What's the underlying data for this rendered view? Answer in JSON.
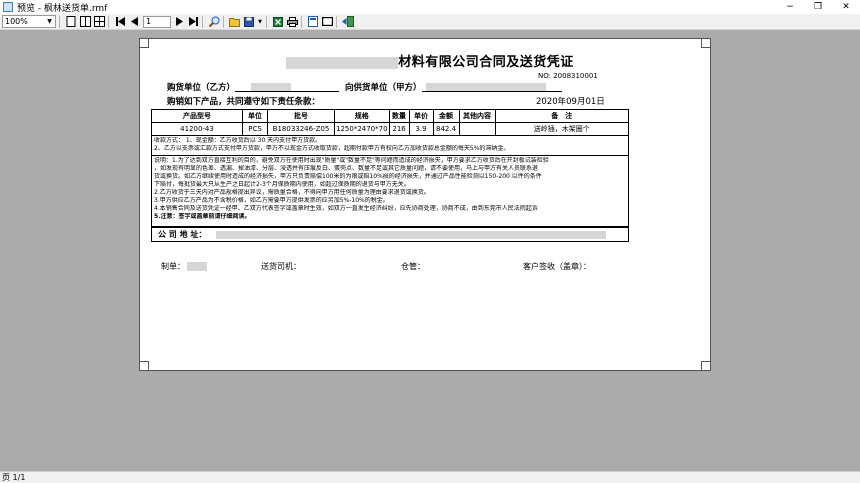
{
  "window": {
    "title": "预览 - 枫林送货单.rmf",
    "controls": [
      "−",
      "❐",
      "✕"
    ]
  },
  "toolbar": {
    "zoom_value": "100%",
    "page_value": "1"
  },
  "document": {
    "title_suffix": "材料有限公司合同及送货凭证",
    "number": "NO: 2008310001",
    "buyer_label": "购货单位（乙方）",
    "seller_label": "向供货单位（甲方）",
    "buyer_line2": "购销如下产品，共同遵守如下责任条款：",
    "date": "2020年09月01日",
    "table": {
      "headers": [
        "产品型号",
        "单位",
        "批号",
        "规格",
        "数量",
        "单价",
        "金额",
        "其他内容",
        "备　注"
      ],
      "row": [
        "41200-43",
        "PCS",
        "B18033246-Z05",
        "1250*2470*70",
        "216",
        "3.9",
        "842.4",
        "",
        "送岭插，木架圈个"
      ]
    },
    "settlement": [
      "收款方式：  1、现金额：乙方收货后以  30  天内支付甲方货款。",
      "              2、乙方以支票或汇款方式支付甲方货款，甲方不以现金方式收取货款，超期付款甲方有权向乙方加收货款总金额的每天5%的滞纳金。"
    ],
    "notes": [
      "说明：1.为了达到双方直接互利的目的，避免双方在使用时出现\"质量\"或\"数量不足\"等问题而造成的经济损失，甲方要求乙方收货后在开封板试装检验",
      "        ，如发现有明显的色差、透漏、掉油漆、分层、浸透并有压痕反白、蛋壳点、数量不足或其它质量问题，请不要使用，马上与甲方有关人员联系退",
      "        货或换货。如乙方继续使用时造成的经济损失，甲方只负责赔偿100米的为限或赔10%损的经济损失，并通过产品性能检测以150-200 以件的条件",
      "        下赔付，每批货最大只从生产之日起计2-3个月保质期内使用，如超过保质期的退货与甲方无关。",
      "2.乙方收货于三天内对产品规格提出异议，需质量合格，不得向甲方用任何质量为理由要求退货或换货。",
      "3.甲方供应乙方产品为不含税价格，如乙方需要甲方提供发票的应另加5%-10%的税金。",
      "4.本销售合同及送货凭证一经甲、乙双方代表签字或盖章时生效，如双方一直发生经济纠纷，应先协商处理，协商不成，由到东莞市人民法院起诉",
      "5.注意：签字或盖章前请仔细阅读。"
    ],
    "address_label": "公 司 地 址：",
    "sign": {
      "maker": "制单：",
      "driver": "送货司机：",
      "warehouse": "仓管：",
      "customer": "客户签收（盖章）："
    }
  },
  "status": {
    "page": "页 1/1"
  }
}
